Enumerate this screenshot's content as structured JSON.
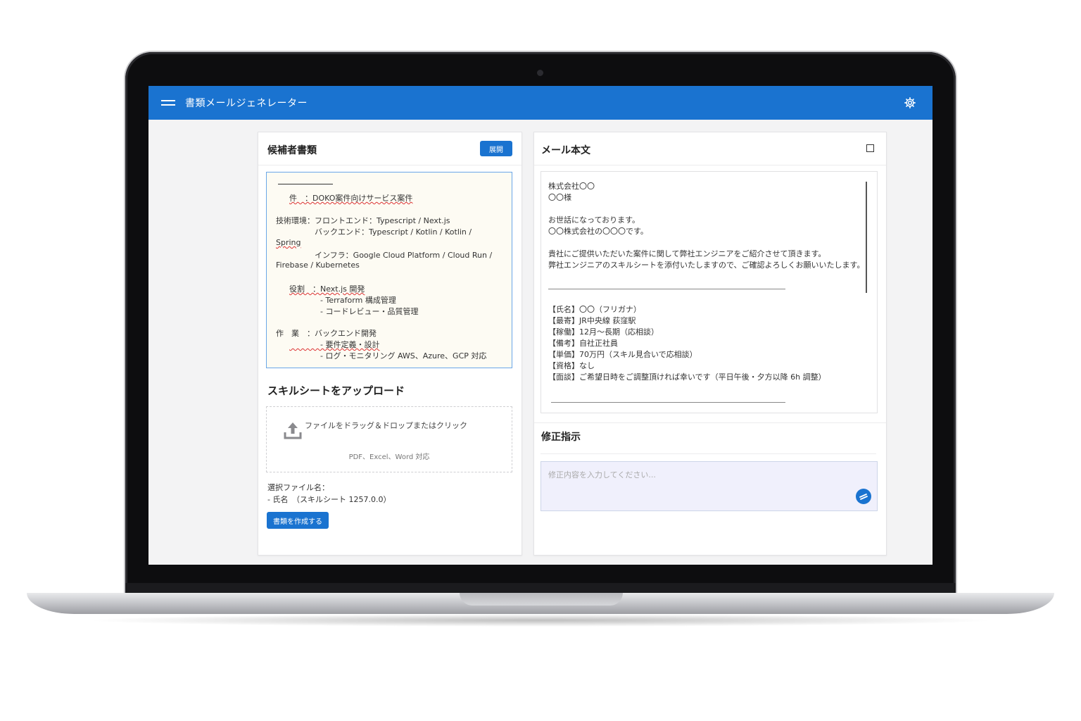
{
  "app": {
    "title": "書類メールジェネレーター",
    "accent_color": "#1a73d0",
    "icons": [
      "menu-icon",
      "gear-icon",
      "expand-icon",
      "upload-icon",
      "send-icon"
    ]
  },
  "left_card": {
    "title": "候補者書類",
    "top_button": "展開",
    "resume_lines": [
      "件　：DOKO案件向けサービス案件",
      "技術環境：フロントエンド：Typescript / Next.js",
      "　　　　　バックエンド：Typescript / Kotlin / Kotlin /",
      "Spring",
      "　　　　　インフラ：Google Cloud Platform / Cloud Run /",
      "Firebase / Kubernetes",
      "役割　：Next.js 開発",
      "　　　　- Terraform 構成管理",
      "　　　　- コードレビュー・品質管理",
      "作　業　：バックエンド開発",
      "　　　　- 要件定義・設計",
      "　　　　- ログ・モニタリング AWS、Azure、GCP 対応"
    ],
    "upload_section_title": "スキルシートをアップロード",
    "upload_text": "ファイルをドラッグ＆ドロップまたはクリック",
    "upload_sub": "PDF、Excel、Word 対応",
    "file_label": "選択ファイル名：",
    "file_info": "- 氏名　（スキルシート 1257.0.0）",
    "generate_button": "書類を作成する"
  },
  "right_card": {
    "title": "メール本文",
    "mail_lines": [
      "株式会社〇〇",
      "〇〇様",
      "",
      "お世話になっております。",
      "〇〇株式会社の〇〇〇です。",
      "",
      "貴社にご提供いただいた案件に関して弊社エンジニアをご紹介させて頂きます。",
      "弊社エンジニアのスキルシートを添付いたしますので、ご確認よろしくお願いいたします。"
    ],
    "detail_lines": [
      "【氏名】〇〇（フリガナ）",
      "【最寄】JR中央線 荻窪駅",
      "【稼働】12月～長期（応相談）",
      "【備考】自社正社員",
      "【単価】70万円（スキル見合いで応相談）",
      "【資格】なし",
      "【面談】ご希望日時をご調整頂ければ幸いです（平日午後・夕方以降 6h 調整）"
    ],
    "instruction_title": "修正指示",
    "instruction_placeholder": "修正内容を入力してください..."
  }
}
